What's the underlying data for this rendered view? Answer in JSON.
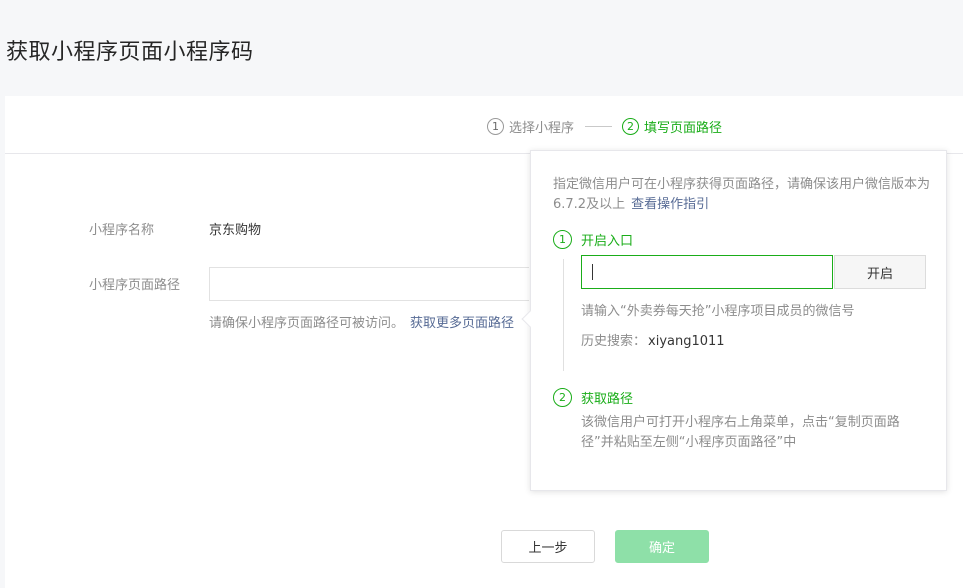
{
  "page": {
    "title": "获取小程序页面小程序码"
  },
  "steps": [
    {
      "num": "1",
      "label": "选择小程序",
      "active": false
    },
    {
      "num": "2",
      "label": "填写页面路径",
      "active": true
    }
  ],
  "form": {
    "name_label": "小程序名称",
    "name_value": "京东购物",
    "path_label": "小程序页面路径",
    "path_value": "",
    "path_hint": "请确保小程序页面路径可被访问。",
    "path_hint_link": "获取更多页面路径"
  },
  "buttons": {
    "prev": "上一步",
    "ok": "确定"
  },
  "popover": {
    "desc": "指定微信用户可在小程序获得页面路径，请确保该用户微信版本为6.7.2及以上",
    "guide_link": "查看操作指引",
    "step1": {
      "num": "1",
      "title": "开启入口"
    },
    "wx_input_value": "",
    "open_button": "开启",
    "input_hint": "请输入“外卖券每天抢”小程序项目成员的微信号",
    "history_label": "历史搜索：",
    "history_value": "xiyang1011",
    "step2": {
      "num": "2",
      "title": "获取路径"
    },
    "step2_desc": "该微信用户可打开小程序右上角菜单，点击“复制页面路径”并粘贴至左侧“小程序页面路径”中"
  },
  "colors": {
    "accent": "#1aad19",
    "link": "#576b95",
    "disabled_green": "#8ee0a8"
  }
}
